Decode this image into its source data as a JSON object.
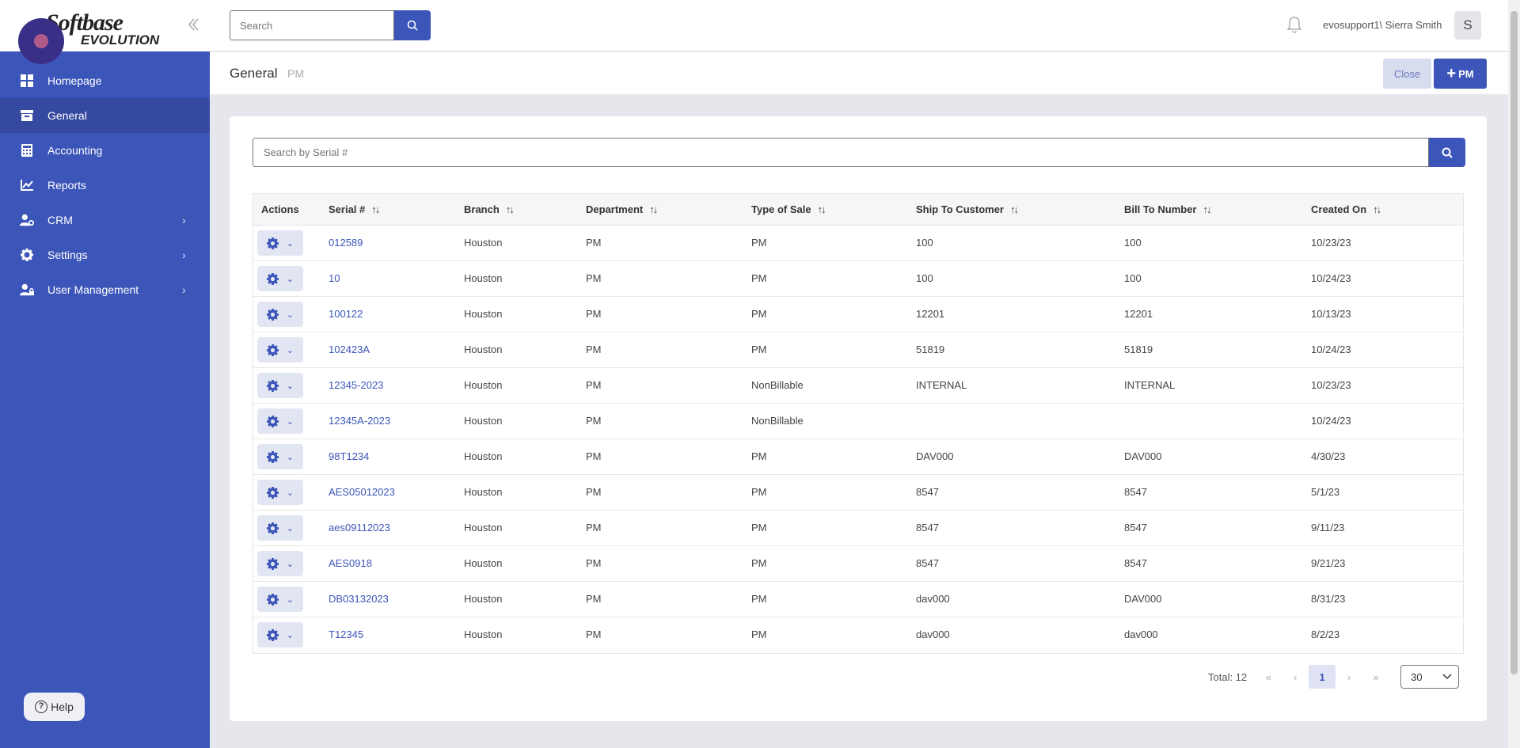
{
  "app": {
    "logo_main": "Softbase",
    "logo_sub": "EVOLUTION"
  },
  "sidebar": {
    "items": [
      {
        "label": "Homepage",
        "icon": "dashboard-icon",
        "active": false,
        "has_children": false
      },
      {
        "label": "General",
        "icon": "archive-icon",
        "active": true,
        "has_children": false
      },
      {
        "label": "Accounting",
        "icon": "calculator-icon",
        "active": false,
        "has_children": false
      },
      {
        "label": "Reports",
        "icon": "chart-line-icon",
        "active": false,
        "has_children": false
      },
      {
        "label": "CRM",
        "icon": "user-gear-icon",
        "active": false,
        "has_children": true
      },
      {
        "label": "Settings",
        "icon": "gear-icon",
        "active": false,
        "has_children": true
      },
      {
        "label": "User Management",
        "icon": "user-lock-icon",
        "active": false,
        "has_children": true
      }
    ],
    "help_label": "Help"
  },
  "topbar": {
    "search_placeholder": "Search",
    "user_name": "evosupport1\\ Sierra Smith",
    "avatar_initial": "S"
  },
  "subheader": {
    "title": "General",
    "subtitle": "PM",
    "close_label": "Close",
    "add_label": "PM"
  },
  "table": {
    "search_placeholder": "Search by Serial #",
    "columns": [
      "Actions",
      "Serial #",
      "Branch",
      "Department",
      "Type of Sale",
      "Ship To Customer",
      "Bill To Number",
      "Created On"
    ],
    "rows": [
      {
        "serial": "012589",
        "branch": "Houston",
        "department": "PM",
        "type_of_sale": "PM",
        "ship_to": "100",
        "bill_to": "100",
        "created_on": "10/23/23"
      },
      {
        "serial": "10",
        "branch": "Houston",
        "department": "PM",
        "type_of_sale": "PM",
        "ship_to": "100",
        "bill_to": "100",
        "created_on": "10/24/23"
      },
      {
        "serial": "100122",
        "branch": "Houston",
        "department": "PM",
        "type_of_sale": "PM",
        "ship_to": "12201",
        "bill_to": "12201",
        "created_on": "10/13/23"
      },
      {
        "serial": "102423A",
        "branch": "Houston",
        "department": "PM",
        "type_of_sale": "PM",
        "ship_to": "51819",
        "bill_to": "51819",
        "created_on": "10/24/23"
      },
      {
        "serial": "12345-2023",
        "branch": "Houston",
        "department": "PM",
        "type_of_sale": "NonBillable",
        "ship_to": "INTERNAL",
        "bill_to": "INTERNAL",
        "created_on": "10/23/23"
      },
      {
        "serial": "12345A-2023",
        "branch": "Houston",
        "department": "PM",
        "type_of_sale": "NonBillable",
        "ship_to": "",
        "bill_to": "",
        "created_on": "10/24/23"
      },
      {
        "serial": "98T1234",
        "branch": "Houston",
        "department": "PM",
        "type_of_sale": "PM",
        "ship_to": "DAV000",
        "bill_to": "DAV000",
        "created_on": "4/30/23"
      },
      {
        "serial": "AES05012023",
        "branch": "Houston",
        "department": "PM",
        "type_of_sale": "PM",
        "ship_to": "8547",
        "bill_to": "8547",
        "created_on": "5/1/23"
      },
      {
        "serial": "aes09112023",
        "branch": "Houston",
        "department": "PM",
        "type_of_sale": "PM",
        "ship_to": "8547",
        "bill_to": "8547",
        "created_on": "9/11/23"
      },
      {
        "serial": "AES0918",
        "branch": "Houston",
        "department": "PM",
        "type_of_sale": "PM",
        "ship_to": "8547",
        "bill_to": "8547",
        "created_on": "9/21/23"
      },
      {
        "serial": "DB03132023",
        "branch": "Houston",
        "department": "PM",
        "type_of_sale": "PM",
        "ship_to": "dav000",
        "bill_to": "DAV000",
        "created_on": "8/31/23"
      },
      {
        "serial": "T12345",
        "branch": "Houston",
        "department": "PM",
        "type_of_sale": "PM",
        "ship_to": "dav000",
        "bill_to": "dav000",
        "created_on": "8/2/23"
      }
    ]
  },
  "pagination": {
    "total_label": "Total: 12",
    "first": "«",
    "prev": "‹",
    "current_page": "1",
    "next": "›",
    "last": "»",
    "page_size": "30"
  },
  "colors": {
    "brand": "#3c55b8",
    "sidebar_active": "#34499f",
    "link": "#3c55b8"
  }
}
